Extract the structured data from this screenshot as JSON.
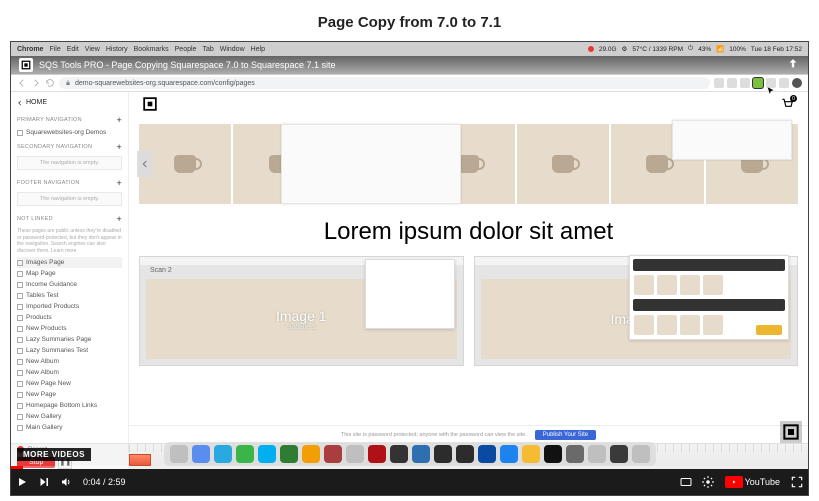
{
  "page_title": "Page Copy from 7.0 to 7.1",
  "youtube": {
    "more_videos": "MORE VIDEOS",
    "time": "0:04 / 2:59",
    "logo_text": "YouTube",
    "video_title": "SQS Tools PRO - Page Copying Squarespace 7.0 to Squarespace 7.1 site"
  },
  "mac_menu": {
    "app": "Chrome",
    "items": [
      "File",
      "Edit",
      "View",
      "History",
      "Bookmarks",
      "People",
      "Tab",
      "Window",
      "Help"
    ],
    "right": [
      "29.0G",
      "57°C / 1339 RPM",
      "43%",
      "100%",
      "Tue 18 Feb 17:52"
    ]
  },
  "browser": {
    "url": "demo-squarewebsites-org.squarespace.com/config/pages"
  },
  "sidebar": {
    "home": "HOME",
    "groups": [
      {
        "title": "PRIMARY NAVIGATION",
        "items": [
          "Squarewebsites-org Demos"
        ]
      },
      {
        "title": "SECONDARY NAVIGATION",
        "empty": "The navigation is empty."
      },
      {
        "title": "FOOTER NAVIGATION",
        "empty": "The navigation is empty."
      },
      {
        "title": "NOT LINKED",
        "note": "These pages are public unless they're disabled or password-protected, but they don't appear in the navigation. Search engines can also discover them. Learn more",
        "items": [
          "Images Page",
          "Map Page",
          "Income Guidance",
          "Tables Test",
          "Imported Products",
          "Products",
          "New Products",
          "Lazy Summaries Page",
          "Lazy Summaries Test",
          "New Album",
          "New Album",
          "New Page New",
          "New Page",
          "Homepage Bottom Links",
          "New Gallery",
          "Main Gallery"
        ]
      }
    ]
  },
  "main": {
    "cart_count": "0",
    "hero_text": "Lorem ipsum dolor sit amet",
    "scan1_caption": "Scan 2",
    "scan1_label": "Image 1",
    "scan1_sub": "Subtitle 1",
    "scan2_label": "Image 2",
    "publish_note": "This site is password protected; anyone with the password can view the site.",
    "publish_btn": "Publish Your Site"
  },
  "camtasia": {
    "record_label": "Record",
    "stop": "Stop"
  },
  "dock_colors": [
    "#bfbfbf",
    "#5b8def",
    "#2aa8e0",
    "#39b54a",
    "#00aff0",
    "#2f7d32",
    "#f29f05",
    "#aa3d3d",
    "#bfbfbf",
    "#b01116",
    "#333333",
    "#2f6fb0",
    "#2c2c2c",
    "#2c2c2c",
    "#0b4aa2",
    "#1d84ef",
    "#f5bc33",
    "#111111",
    "#6a6a6a",
    "#bfbfbf",
    "#3a3a3a",
    "#bfbfbf"
  ]
}
